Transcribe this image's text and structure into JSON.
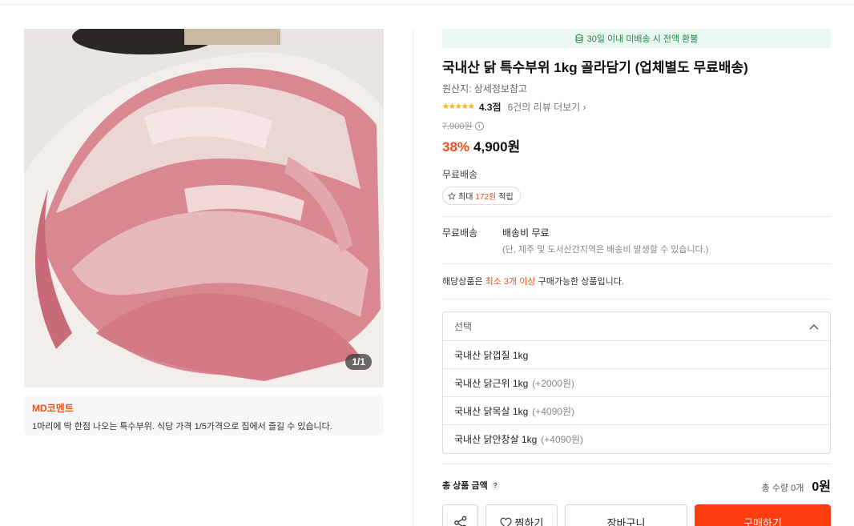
{
  "gallery": {
    "counter": "1/1"
  },
  "md_comment": {
    "title": "MD코멘트",
    "text": "1마리에 딱 한점 나오는 특수부위. 식당 가격 1/5가격으로 집에서 즐길 수 있습니다."
  },
  "product": {
    "banner": "30일 이내 미배송 시 전액 환불",
    "title": "국내산 닭 특수부위 1kg 골라담기 (업체별도 무료배송)",
    "origin": "원산지: 상세정보참고",
    "rating_stars": "★★★★★",
    "rating_score": "4.3점",
    "review_link": "6건의 리뷰 더보기 ›",
    "original_price": "7,900원",
    "info_icon": "i",
    "discount": "38%",
    "price": "4,900원",
    "shipping_badge": "무료배송",
    "points_prefix": "최대",
    "points_value": "172원",
    "points_suffix": "적립"
  },
  "shipping": {
    "label": "무료배송",
    "main": "배송비 무료",
    "sub": "(단, 제주 및 도서산간지역은 배송비 발생할 수 있습니다.)"
  },
  "min_qty": {
    "prefix": "해당상품은",
    "highlight": "최소 3개 이상",
    "suffix": "구매가능한 상품입니다."
  },
  "select": {
    "placeholder": "선택",
    "options": [
      {
        "label": "국내산 닭껍질 1kg",
        "extra": ""
      },
      {
        "label": "국내산 닭근위 1kg",
        "extra": "(+2000원)"
      },
      {
        "label": "국내산 닭목살 1kg",
        "extra": "(+4090원)"
      },
      {
        "label": "국내산 닭안창살 1kg",
        "extra": "(+4090원)"
      }
    ]
  },
  "total": {
    "label": "총 상품 금액",
    "help": "?",
    "qty": "총 수량 0개",
    "amount": "0원"
  },
  "buttons": {
    "wish": "찜하기",
    "cart": "장바구니",
    "buy": "구매하기"
  },
  "colors": {
    "accent": "#ff3d0f",
    "discount": "#f2501f",
    "banner_bg": "#eaf7ef",
    "banner_text": "#1d8a4b",
    "star": "#f7b500"
  },
  "icons": [
    "coin-icon",
    "star-icon",
    "info-icon",
    "chevron-up-icon",
    "question-icon",
    "share-icon",
    "heart-icon"
  ]
}
